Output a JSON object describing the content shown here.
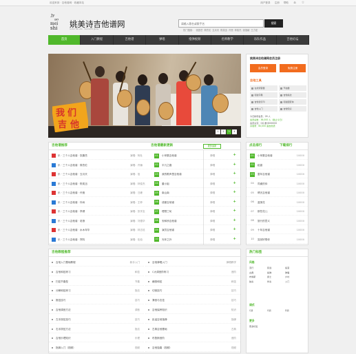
{
  "topbar": {
    "left_text": "欢迎来到 · 吉他谱网 · 收藏本站",
    "links": [
      "用户登录",
      "注册",
      "帮助"
    ],
    "icon_names": [
      "home-icon",
      "star-icon"
    ]
  },
  "header": {
    "brand_name": "姚美诗吉他谱网",
    "brand_sub": "Guitar tab site · Yaomeishi guitar",
    "logo_letters": [
      "Jy",
      "ao",
      "mei",
      "shi"
    ],
    "search_placeholder": "请输入歌名或歌手名",
    "search_button": "搜索",
    "hot_label": "热门搜索：",
    "hot_terms": [
      "张震岳",
      "周杰伦",
      "五月天",
      "陈奕迅",
      "许嵩",
      "林俊杰",
      "张靓颖",
      "王力宏"
    ]
  },
  "nav": {
    "items": [
      "首页",
      "入门教程",
      "吉他谱",
      "弹唱",
      "指弹视频",
      "名师教学",
      "乐队作品",
      "吉他论坛"
    ],
    "active_index": 0
  },
  "slider": {
    "pages": [
      "1",
      "2",
      "3",
      "4"
    ],
    "active_page": 3,
    "banner_text": [
      "我",
      "们",
      "吉",
      "他"
    ]
  },
  "vip": {
    "title": "姚美诗吉他谱网会员注册",
    "login_button": "会员登录",
    "register_button": "免费注册",
    "tools_title": "吉他工具",
    "tools": [
      "在线调音器",
      "节拍器",
      "和弦字典",
      "吉他指法",
      "吉他谱打印",
      "和弦图查询",
      "吉他入门",
      "吉他知识"
    ],
    "stats": [
      "今日新增会员：26 人",
      "会员总数：36,000 人（截止今日）",
      "会员交流：QQ 群 6000000",
      "共收录：60,000 首吉他谱"
    ]
  },
  "recommend": {
    "title": "吉他谱推荐",
    "items": [
      {
        "name": "乐 · 三个人吉他谱 · 张震岳",
        "meta": "演唱：阿杜"
      },
      {
        "name": "乐 · 三个人吉他谱 · 周杰伦",
        "meta": "演唱：许巍"
      },
      {
        "name": "乐 · 三个人吉他谱 · 五月天",
        "meta": "演唱：信"
      },
      {
        "name": "乐 · 三个人吉他谱 · 陈奕迅",
        "meta": "演唱：林俊杰"
      },
      {
        "name": "乐 · 三个人吉他谱 · 许嵩",
        "meta": "演唱：汪峰"
      },
      {
        "name": "乐 · 三个人吉他谱 · 朴树",
        "meta": "演唱：王菲"
      },
      {
        "name": "乐 · 三个人吉他谱 · 李健",
        "meta": "演唱：张学友"
      },
      {
        "name": "乐 · 三个人吉他谱 · 老狼",
        "meta": "演唱：刘德华"
      },
      {
        "name": "乐 · 三个人吉他谱 · 水木年华",
        "meta": "演唱：林志炫"
      },
      {
        "name": "乐 · 三个人吉他谱 · 郑钧",
        "meta": "演唱：伍佰"
      }
    ]
  },
  "latest": {
    "title": "吉他谱最新更新",
    "more_button": "更多最新",
    "items": [
      {
        "name": "小苹果吉他谱",
        "meta": "弹唱"
      },
      {
        "name": "平凡之路",
        "meta": "弹唱"
      },
      {
        "name": "我的歌声里吉他谱",
        "meta": "弹唱"
      },
      {
        "name": "董小姐",
        "meta": "弹唱"
      },
      {
        "name": "南山南",
        "meta": "弹唱"
      },
      {
        "name": "成都吉他谱",
        "meta": "弹唱"
      },
      {
        "name": "理想三旬",
        "meta": "弹唱"
      },
      {
        "name": "安和桥吉他谱",
        "meta": "弹唱"
      },
      {
        "name": "演员吉他谱",
        "meta": "弹唱"
      },
      {
        "name": "光年之外",
        "meta": "弹唱"
      }
    ]
  },
  "ranking": {
    "title_left": "点击排行",
    "title_right": "下载排行",
    "items": [
      {
        "name": "小苹果吉他谱",
        "count": "10000"
      },
      {
        "name": "稻香",
        "count": "10000"
      },
      {
        "name": "童年吉他谱",
        "count": "10000"
      },
      {
        "name": "同桌的你",
        "count": "10000"
      },
      {
        "name": "晴天吉他谱",
        "count": "10000"
      },
      {
        "name": "蓝莲花",
        "count": "10000"
      },
      {
        "name": "那些花儿",
        "count": "10000"
      },
      {
        "name": "旅行的意义",
        "count": "10000"
      },
      {
        "name": "十年吉他谱",
        "count": "10000"
      },
      {
        "name": "突然好想你",
        "count": "10000"
      }
    ]
  },
  "teacher": {
    "title": "吉他教程推荐",
    "left": [
      {
        "name": "吉他入门基础教程",
        "meta": "新手入门"
      },
      {
        "name": "吉他和弦练习",
        "meta": "和弦"
      },
      {
        "name": "扫弦节奏型",
        "meta": "节奏"
      },
      {
        "name": "分解和弦练习",
        "meta": "指法"
      },
      {
        "name": "推弦技巧",
        "meta": "技巧"
      },
      {
        "name": "吉他调音方法",
        "meta": "调音"
      },
      {
        "name": "左手按弦技巧",
        "meta": "技巧"
      },
      {
        "name": "右手拨弦方法",
        "meta": "指法"
      },
      {
        "name": "吉他乐理知识",
        "meta": "乐理"
      },
      {
        "name": "指弹入门（视频）",
        "meta": "视频"
      }
    ],
    "right": [
      {
        "name": "吉他弹唱入门",
        "meta": "弹唱教学"
      },
      {
        "name": "C大调音阶练习",
        "meta": "音阶"
      },
      {
        "name": "横按和弦",
        "meta": "和弦"
      },
      {
        "name": "切音技巧",
        "meta": "技巧"
      },
      {
        "name": "滑音与击弦",
        "meta": "技巧"
      },
      {
        "name": "吉他保养知识",
        "meta": "知识"
      },
      {
        "name": "民谣吉他指弹",
        "meta": "指弹"
      },
      {
        "name": "古典吉他基础",
        "meta": "古典"
      },
      {
        "name": "布鲁斯音阶",
        "meta": "音阶"
      },
      {
        "name": "吉他独奏（视频）",
        "meta": "视频"
      }
    ]
  },
  "tags": {
    "title": "热门标签",
    "sections": [
      {
        "name": "风格",
        "items": [
          "流行",
          "民谣",
          "摇滚",
          "古典",
          "指弹",
          "弹唱",
          "布鲁斯",
          "爵士",
          "乡村",
          "独奏",
          "伴奏",
          "入门"
        ]
      },
      {
        "name": "调式",
        "items": [
          "C调",
          "G调",
          "D调"
        ]
      },
      {
        "name": "更多",
        "items": [
          "更多标签"
        ]
      }
    ]
  },
  "colors": {
    "accent": "#50b82b",
    "orange": "#f26c1e",
    "nav": "#3b3b3b"
  }
}
